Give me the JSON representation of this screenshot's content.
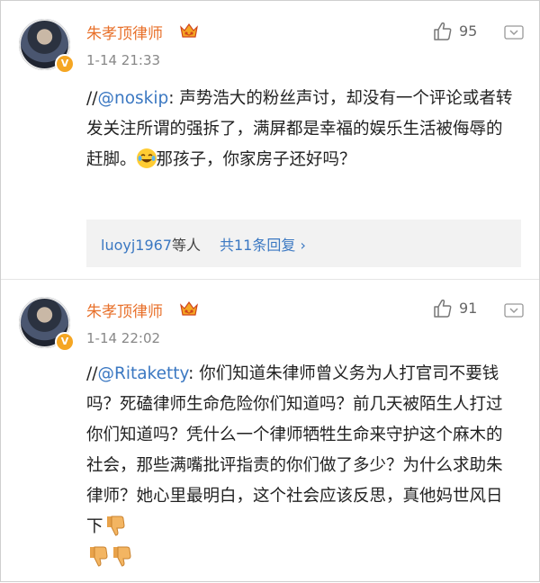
{
  "comments": [
    {
      "username": "朱孝顶律师",
      "timestamp": "1-14 21:33",
      "likes": "95",
      "prefix": "//",
      "mention": "@noskip",
      "text": ": 声势浩大的粉丝声讨，却没有一个评论或者转发关注所谓的强拆了，满屏都是幸福的娱乐生活被侮辱的赶脚。",
      "text_after_emoji": "那孩子，你家房子还好吗？",
      "emoji": "laughing-crying-face",
      "replies": {
        "user": "luoyj1967",
        "user_suffix": "等人",
        "link": "共11条回复",
        "chevron": "›"
      }
    },
    {
      "username": "朱孝顶律师",
      "timestamp": "1-14 22:02",
      "likes": "91",
      "prefix": "//",
      "mention": "@Ritaketty",
      "text": ": 你们知道朱律师曾义务为人打官司不要钱吗？死磕律师生命危险你们知道吗？前几天被陌生人打过你们知道吗？凭什么一个律师牺牲生命来守护这个麻木的社会，那些满嘴批评指责的你们做了多少？为什么求助朱律师？她心里最明白，这个社会应该反思，真他妈世风日下",
      "emoji": "thumbs-down"
    }
  ],
  "colors": {
    "username": "#e8702a",
    "link": "#3b78c2",
    "meta": "#888888",
    "replies_bg": "#f2f2f2"
  },
  "icons": {
    "like": "thumbs-up-outline-icon",
    "more": "chevron-down-box-icon",
    "vip": "crown-vip-icon",
    "verified": "verified-v-badge-icon"
  }
}
